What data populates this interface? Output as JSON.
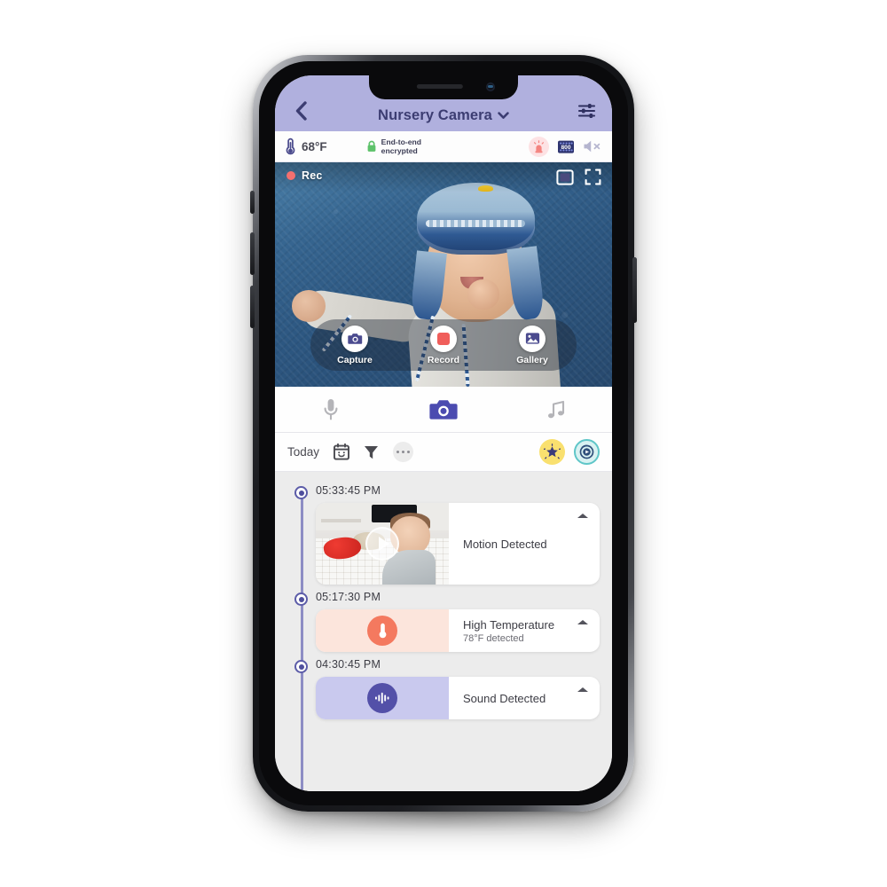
{
  "app": {
    "header": {
      "back_icon": "chevron-left-icon",
      "title": "Nursery Camera",
      "dropdown_icon": "chevron-down-icon",
      "settings_icon": "sliders-icon",
      "bg_color": "#b0b0de",
      "title_color": "#3c3d72"
    },
    "status_strip": {
      "temperature": "68°F",
      "temperature_icon": "thermometer-icon",
      "lock_icon": "lock-icon",
      "encryption_line1": "End-to-end",
      "encryption_line2": "encrypted",
      "alarm_icon": "siren-icon",
      "night_vision_icon": "night-vision-icon",
      "mute_icon": "speaker-muted-icon",
      "lock_color": "#5dc26a",
      "alarm_color": "#f4837f"
    },
    "video": {
      "rec_label": "Rec",
      "rec_dot_color": "#f4706f",
      "pip_icon": "picture-in-picture-icon",
      "fullscreen_icon": "fullscreen-icon",
      "controls": [
        {
          "label": "Capture",
          "icon": "camera-icon"
        },
        {
          "label": "Record",
          "icon": "record-square-icon"
        },
        {
          "label": "Gallery",
          "icon": "image-icon"
        }
      ]
    },
    "mode_tabs": [
      {
        "name": "microphone",
        "icon": "microphone-icon",
        "active": false
      },
      {
        "name": "camera",
        "icon": "camera-icon",
        "active": true
      },
      {
        "name": "music",
        "icon": "music-note-icon",
        "active": false
      }
    ],
    "filter_bar": {
      "today_label": "Today",
      "calendar_icon": "calendar-icon",
      "filter_icon": "funnel-icon",
      "more_icon": "ellipsis-icon",
      "star_badge_icon": "sparkle-star-icon",
      "replay_badge_icon": "replay-icon",
      "star_badge_color": "#f9e06f",
      "replay_badge_color": "#5fc6c8"
    },
    "timeline": {
      "line_color": "#8d8dc4",
      "entries": [
        {
          "time": "05:33:45 PM",
          "title": "Motion Detected",
          "subtitle": "",
          "media_type": "video-thumbnail",
          "media_icon": "play-icon",
          "collapse_icon": "chevron-up-icon"
        },
        {
          "time": "05:17:30 PM",
          "title": "High Temperature",
          "subtitle": "78°F  detected",
          "media_type": "icon-tile",
          "media_icon": "thermometer-icon",
          "media_bg": "#fce5dc",
          "media_fg": "#f4795f",
          "collapse_icon": "chevron-up-icon"
        },
        {
          "time": "04:30:45 PM",
          "title": "Sound Detected",
          "subtitle": "",
          "media_type": "icon-tile",
          "media_icon": "sound-wave-icon",
          "media_bg": "#c9c9ee",
          "media_fg": "#5350a8",
          "collapse_icon": "chevron-up-icon"
        }
      ]
    }
  }
}
